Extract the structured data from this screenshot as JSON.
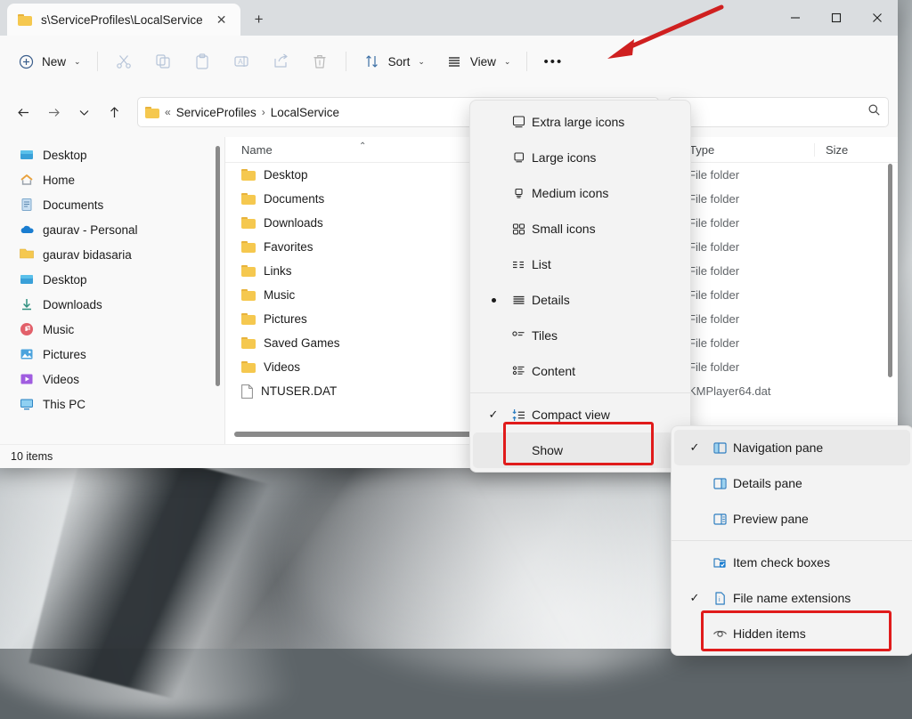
{
  "window": {
    "tab": {
      "title": "s\\ServiceProfiles\\LocalService",
      "icon": "folder-icon",
      "close_label": "✕",
      "new_tab_label": "+"
    },
    "controls": {
      "minimize": "minimize-icon",
      "maximize": "maximize-icon",
      "close": "close-icon"
    }
  },
  "toolbar": {
    "new_label": "New",
    "new_icon": "plus-circle-icon",
    "cut_icon": "scissors-icon",
    "copy_icon": "copy-icon",
    "paste_icon": "paste-icon",
    "rename_icon": "rename-icon",
    "share_icon": "share-icon",
    "delete_icon": "trash-icon",
    "sort_label": "Sort",
    "sort_icon": "sort-arrows-icon",
    "view_label": "View",
    "view_icon": "hamburger-icon",
    "more_label": "•••",
    "caret": "⌄"
  },
  "address": {
    "back_icon": "arrow-left-icon",
    "forward_icon": "arrow-right-icon",
    "recent_icon": "chevron-down-icon",
    "up_icon": "arrow-up-icon",
    "overflow": "«",
    "crumbs": [
      "ServiceProfiles",
      "LocalService"
    ],
    "separator": "›",
    "dropdown_caret": "⌄"
  },
  "search": {
    "value": "",
    "placeholder": "",
    "icon": "search-icon"
  },
  "sidebar": {
    "items": [
      {
        "label": "Desktop",
        "icon": "desktop-icon"
      },
      {
        "label": "Home",
        "icon": "home-icon"
      },
      {
        "label": "Documents",
        "icon": "documents-icon"
      },
      {
        "label": "gaurav - Personal",
        "icon": "onedrive-icon"
      },
      {
        "label": "gaurav bidasaria",
        "icon": "folder-icon"
      },
      {
        "label": "Desktop",
        "icon": "desktop-icon"
      },
      {
        "label": "Downloads",
        "icon": "download-icon"
      },
      {
        "label": "Music",
        "icon": "music-icon"
      },
      {
        "label": "Pictures",
        "icon": "pictures-icon"
      },
      {
        "label": "Videos",
        "icon": "videos-icon"
      },
      {
        "label": "This PC",
        "icon": "thispc-icon"
      }
    ]
  },
  "filelist": {
    "columns": {
      "name": "Name",
      "date": "",
      "type": "Type",
      "size": "Size"
    },
    "sort_indicator": "⌃",
    "rows": [
      {
        "name": "Desktop",
        "icon": "folder-icon",
        "date": "",
        "type": "File folder",
        "size": ""
      },
      {
        "name": "Documents",
        "icon": "folder-icon",
        "date": "",
        "type": "File folder",
        "size": ""
      },
      {
        "name": "Downloads",
        "icon": "folder-icon",
        "date": "",
        "type": "File folder",
        "size": ""
      },
      {
        "name": "Favorites",
        "icon": "folder-icon",
        "date": "",
        "type": "File folder",
        "size": ""
      },
      {
        "name": "Links",
        "icon": "folder-icon",
        "date": "",
        "type": "File folder",
        "size": ""
      },
      {
        "name": "Music",
        "icon": "folder-icon",
        "date": "",
        "type": "File folder",
        "size": ""
      },
      {
        "name": "Pictures",
        "icon": "folder-icon",
        "date": "",
        "type": "File folder",
        "size": ""
      },
      {
        "name": "Saved Games",
        "icon": "folder-icon",
        "date": "",
        "type": "File folder",
        "size": ""
      },
      {
        "name": "Videos",
        "icon": "folder-icon",
        "date": "",
        "type": "File folder",
        "size": ""
      },
      {
        "name": "NTUSER.DAT",
        "icon": "file-icon",
        "date": "",
        "type": "KMPlayer64.dat",
        "size": ""
      }
    ]
  },
  "statusbar": {
    "item_count": "10 items"
  },
  "view_menu": {
    "items": [
      {
        "label": "Extra large icons",
        "icon": "extra-large-icons-icon",
        "mark": "",
        "submenu": ""
      },
      {
        "label": "Large icons",
        "icon": "large-icons-icon",
        "mark": "",
        "submenu": ""
      },
      {
        "label": "Medium icons",
        "icon": "medium-icons-icon",
        "mark": "",
        "submenu": ""
      },
      {
        "label": "Small icons",
        "icon": "small-icons-icon",
        "mark": "",
        "submenu": ""
      },
      {
        "label": "List",
        "icon": "list-icon",
        "mark": "",
        "submenu": ""
      },
      {
        "label": "Details",
        "icon": "details-icon",
        "mark": "radio",
        "submenu": ""
      },
      {
        "label": "Tiles",
        "icon": "tiles-icon",
        "mark": "",
        "submenu": ""
      },
      {
        "label": "Content",
        "icon": "content-icon",
        "mark": "",
        "submenu": ""
      },
      {
        "label": "Compact view",
        "icon": "compact-view-icon",
        "mark": "✓",
        "submenu": ""
      },
      {
        "label": "Show",
        "icon": "",
        "mark": "",
        "submenu": "›"
      }
    ]
  },
  "show_menu": {
    "items": [
      {
        "label": "Navigation pane",
        "icon": "navigation-pane-icon",
        "mark": "✓"
      },
      {
        "label": "Details pane",
        "icon": "details-pane-icon",
        "mark": ""
      },
      {
        "label": "Preview pane",
        "icon": "preview-pane-icon",
        "mark": ""
      },
      {
        "label": "Item check boxes",
        "icon": "item-check-boxes-icon",
        "mark": ""
      },
      {
        "label": "File name extensions",
        "icon": "file-name-extensions-icon",
        "mark": "✓"
      },
      {
        "label": "Hidden items",
        "icon": "hidden-items-icon",
        "mark": ""
      }
    ]
  },
  "annotations": {
    "accent_red": "#e01b1b",
    "arrow": "red-arrow-pointing-to-view-button",
    "highlight_show": "Show",
    "highlight_hidden": "Hidden items"
  }
}
